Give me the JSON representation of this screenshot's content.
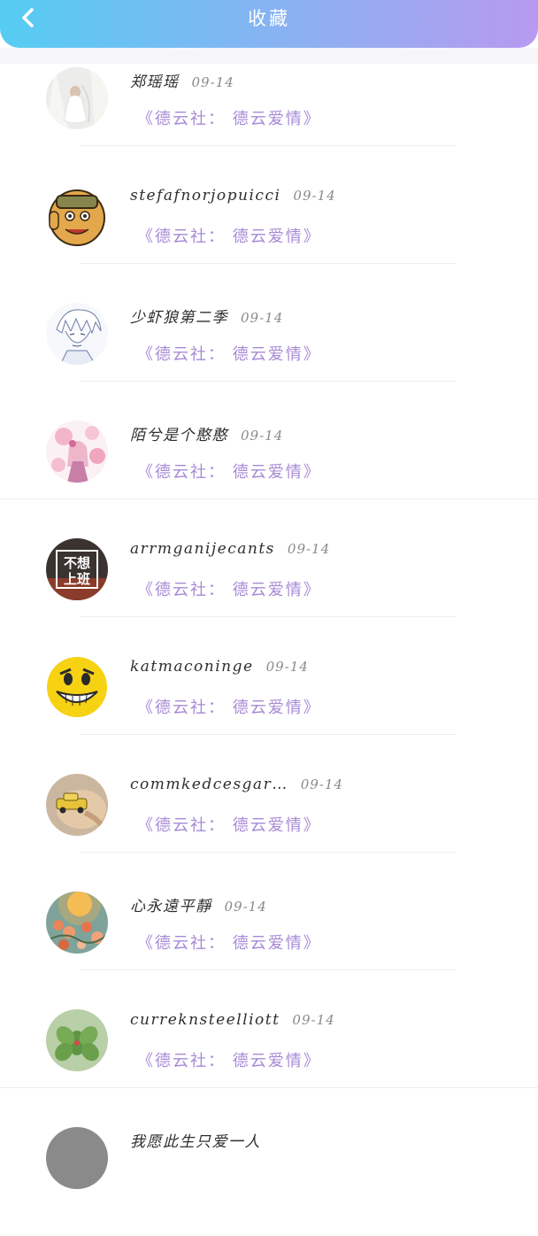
{
  "header": {
    "title": "收藏",
    "gradient_start": "#55cdf3",
    "gradient_end": "#b79af0",
    "back_icon": "chevron-left-icon"
  },
  "colors": {
    "subtitle": "#a78ad6",
    "name": "#2e2e2e",
    "date": "#8a8a8a"
  },
  "favorites": [
    {
      "name": "郑瑶瑶",
      "date": "09-14",
      "work": "《德云社： 德云爱情》",
      "avatar": "bride-photo-avatar"
    },
    {
      "name": "stefafnorjopuicci",
      "date": "09-14",
      "work": "《德云社： 德云爱情》",
      "avatar": "cartoon-character-avatar"
    },
    {
      "name": "少虾狼第二季",
      "date": "09-14",
      "work": "《德云社： 德云爱情》",
      "avatar": "anime-sketch-avatar"
    },
    {
      "name": "陌兮是个憨憨",
      "date": "09-14",
      "work": "《德云社： 德云爱情》",
      "avatar": "anime-girl-avatar"
    },
    {
      "name": "arrmganijecants",
      "date": "09-14",
      "work": "《德云社： 德云爱情》",
      "avatar": "text-badge-avatar",
      "avatar_text": [
        "不想",
        "上班"
      ]
    },
    {
      "name": "katmaconinge",
      "date": "09-14",
      "work": "《德云社： 德云爱情》",
      "avatar": "smiley-face-avatar"
    },
    {
      "name": "commkedcesgar…",
      "date": "09-14",
      "work": "《德云社： 德云爱情》",
      "avatar": "toy-car-avatar"
    },
    {
      "name": "心永遠平靜",
      "date": "09-14",
      "work": "《德云社： 德云爱情》",
      "avatar": "flowers-sunset-avatar"
    },
    {
      "name": "curreknsteelliott",
      "date": "09-14",
      "work": "《德云社： 德云爱情》",
      "avatar": "succulent-plant-avatar"
    },
    {
      "name": "我愿此生只爱一人",
      "date": "",
      "work": "",
      "avatar": "partial-avatar"
    }
  ]
}
